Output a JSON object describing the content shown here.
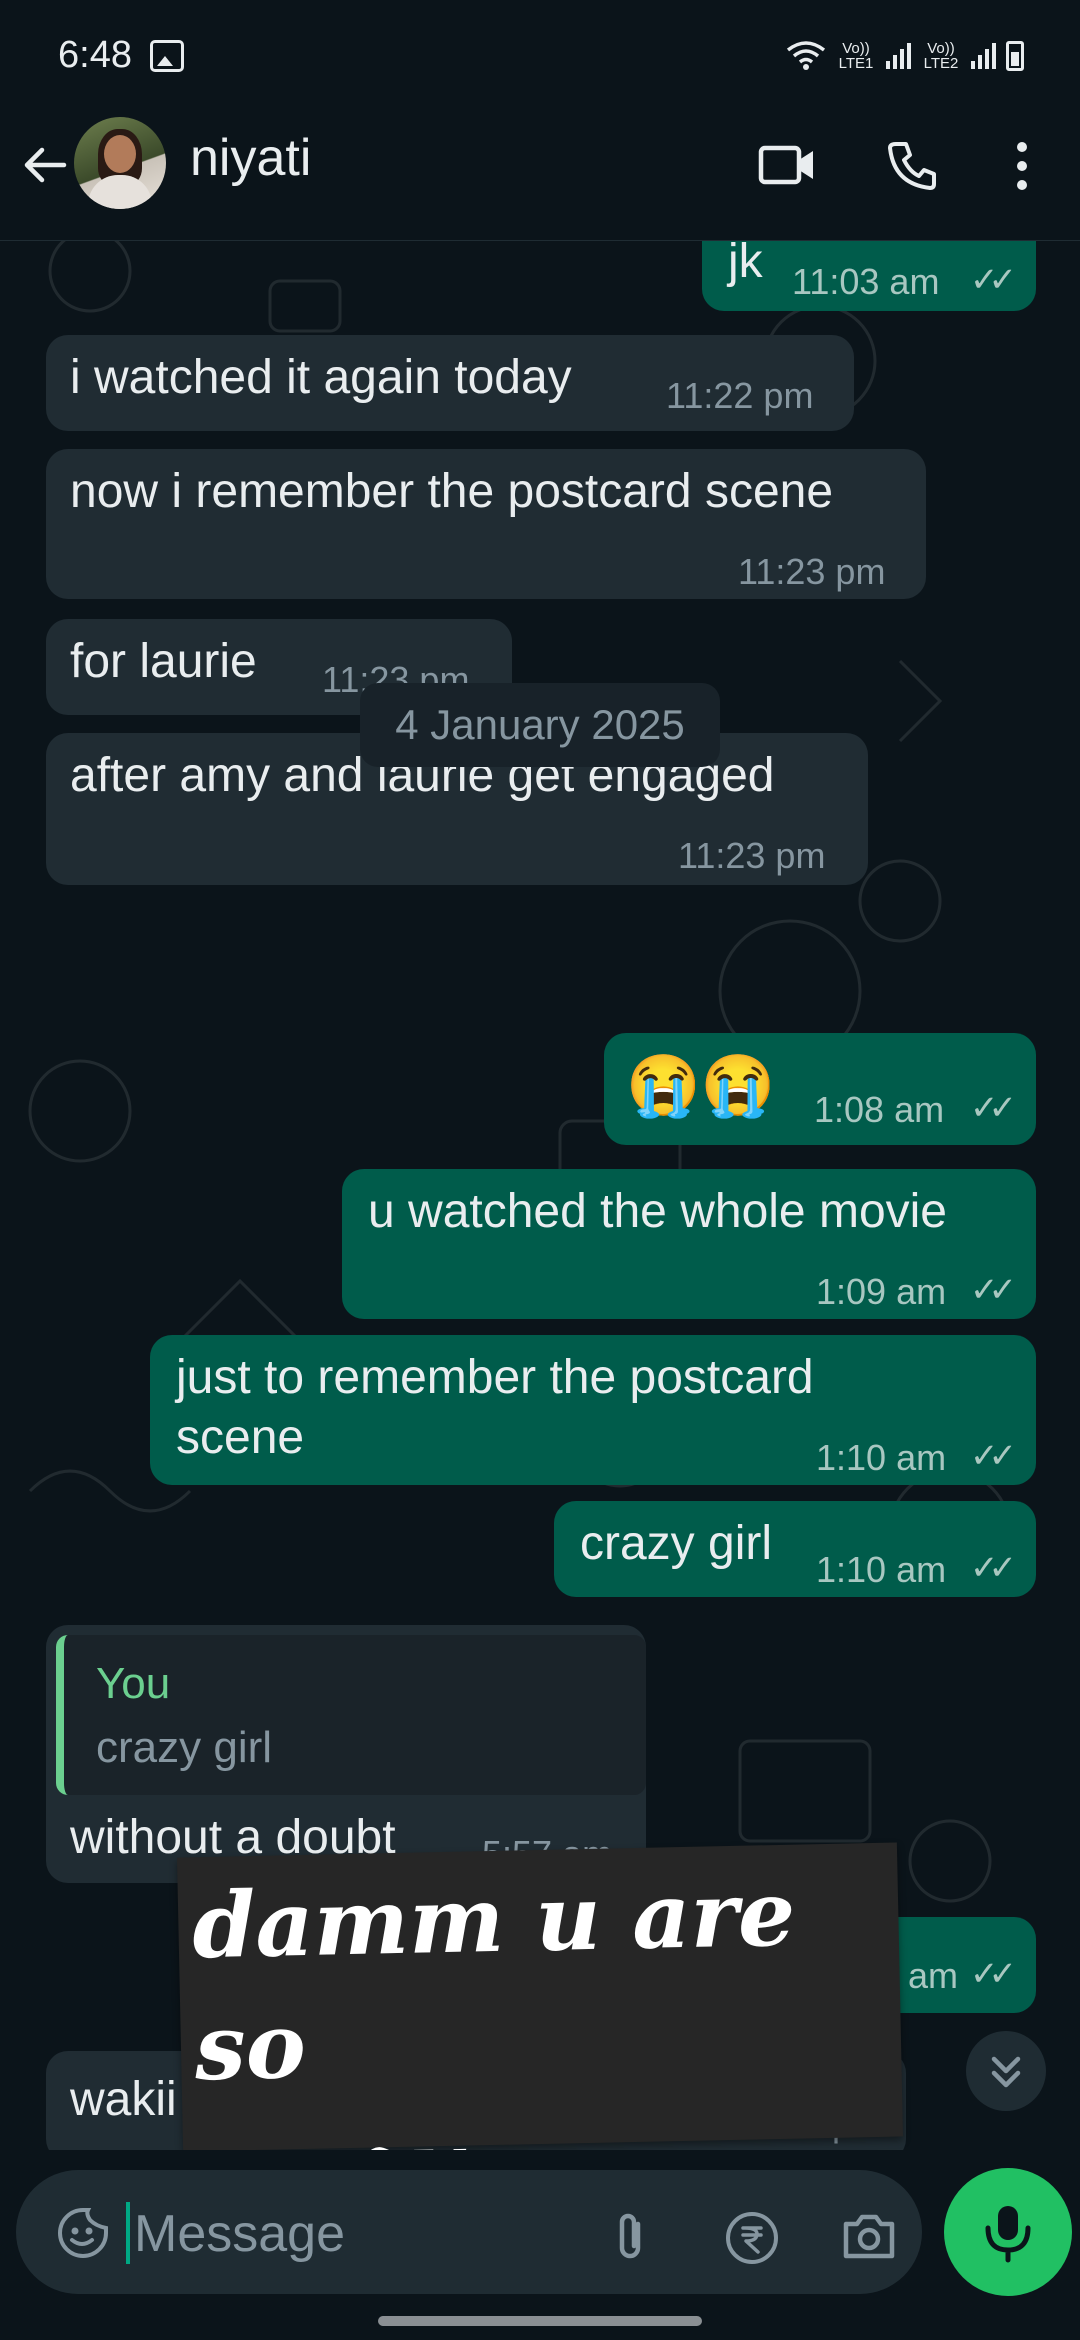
{
  "status_bar": {
    "time": "6:48",
    "sim1": "Vo)) LTE1",
    "sim2": "Vo)) LTE2"
  },
  "header": {
    "contact_name": "niyati"
  },
  "messages": [
    {
      "direction": "out",
      "text": "jk",
      "time": "11:03 am",
      "status": "read"
    },
    {
      "direction": "in",
      "text": "i watched it again today",
      "time": "11:22 pm"
    },
    {
      "direction": "in",
      "text": "now i remember the postcard scene",
      "time": "11:23 pm"
    },
    {
      "direction": "in",
      "text": "for laurie",
      "time": "11:23 pm"
    },
    {
      "direction": "in",
      "text": "after amy and laurie get engaged",
      "time": "11:23 pm"
    },
    {
      "direction": "out",
      "text": "😭😭",
      "time": "1:08 am",
      "status": "read"
    },
    {
      "direction": "out",
      "text": "u watched the whole movie",
      "time": "1:09 am",
      "status": "read"
    },
    {
      "direction": "out",
      "text_line1": "just to remember the postcard",
      "text_line2": "scene",
      "time": "1:10 am",
      "status": "read"
    },
    {
      "direction": "out",
      "text": "crazy girl",
      "time": "1:10 am",
      "status": "read"
    },
    {
      "direction": "in",
      "reply_author": "You",
      "reply_text": "crazy girl",
      "text": "without a doubt",
      "time": "5:57 am"
    },
    {
      "direction": "out",
      "time_partial": "am",
      "status": "read"
    },
    {
      "direction": "in",
      "text_partial": "wakii",
      "time_partial": "…5 pm"
    }
  ],
  "date_separator": "4 January 2025",
  "sticker": {
    "text": "damm u are so\ncrazy"
  },
  "composer": {
    "placeholder": "Message"
  },
  "icons": [
    "back-arrow",
    "video-call",
    "voice-call",
    "more-vertical",
    "emoji",
    "attach-paperclip",
    "rupee-payment",
    "camera",
    "microphone",
    "scroll-down-chevrons"
  ],
  "colors": {
    "outgoing_bubble": "#005c4b",
    "incoming_bubble": "#202c33",
    "accent_green": "#21c063",
    "background": "#0b141a"
  }
}
